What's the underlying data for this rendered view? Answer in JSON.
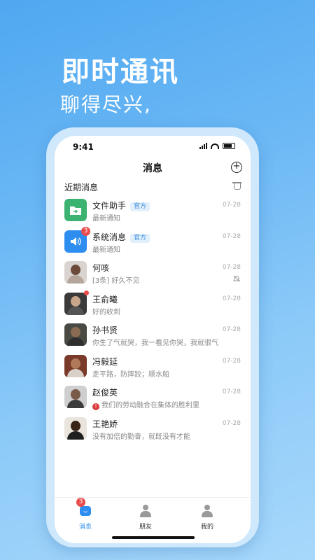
{
  "promo": {
    "headline": "即时通讯",
    "subline": "聊得尽兴,"
  },
  "status_bar": {
    "time": "9:41"
  },
  "nav": {
    "title": "消息"
  },
  "section": {
    "title": "近期消息"
  },
  "conversations": [
    {
      "name": "文件助手",
      "tag": "官方",
      "preview": "最新通知",
      "time": "07-28",
      "avatar_color": "#3cb371",
      "icon": "folder-icon"
    },
    {
      "name": "系统消息",
      "tag": "官方",
      "preview": "最新通知",
      "time": "07-28",
      "badge": "3",
      "avatar_color": "#2e8ef0",
      "icon": "speaker-icon"
    },
    {
      "name": "何咳",
      "preview": "[3条] 好久不见",
      "time": "07-28",
      "muted": true,
      "icon": "mute-bell-icon"
    },
    {
      "name": "王俞曦",
      "preview": "好的收到",
      "time": "07-28",
      "dot": true
    },
    {
      "name": "孙书贤",
      "preview": "你生了气就哭，我一看见你哭，我就很气",
      "time": "07-28"
    },
    {
      "name": "冯毅延",
      "preview": "走平路，防摔跤；顺水船",
      "time": "07-28"
    },
    {
      "name": "赵俊英",
      "preview": "我们的劳动融合在集体的胜利里",
      "time": "07-28",
      "error": true
    },
    {
      "name": "王艳娇",
      "preview": "没有加倍的勤奋，就既没有才能",
      "time": "07-28"
    }
  ],
  "tabs": [
    {
      "label": "消息",
      "badge": "3",
      "active": true,
      "icon": "message-icon"
    },
    {
      "label": "朋友",
      "icon": "friends-icon"
    },
    {
      "label": "我的",
      "icon": "profile-icon"
    }
  ],
  "colors": {
    "accent": "#2e8ef0",
    "badge": "#e84b4b",
    "background_top": "#4fa8f0",
    "background_bottom": "#a7d8fb"
  }
}
